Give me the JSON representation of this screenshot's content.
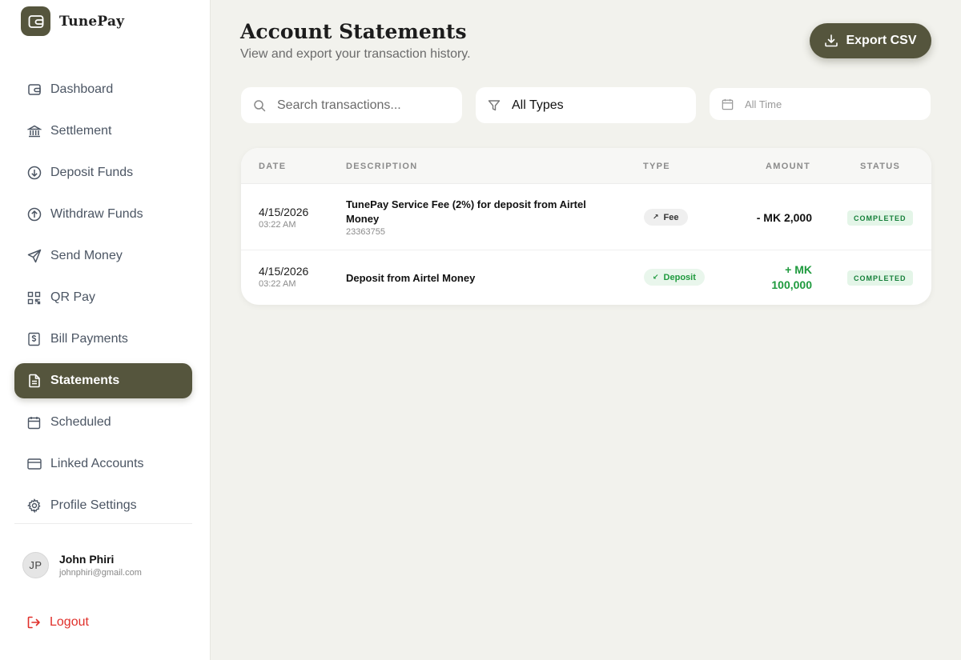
{
  "brand": {
    "name": "TunePay"
  },
  "sidebar": {
    "items": [
      {
        "label": "Dashboard",
        "icon": "wallet-icon"
      },
      {
        "label": "Settlement",
        "icon": "bank-icon"
      },
      {
        "label": "Deposit Funds",
        "icon": "arrow-down-circle-icon"
      },
      {
        "label": "Withdraw Funds",
        "icon": "arrow-up-circle-icon"
      },
      {
        "label": "Send Money",
        "icon": "send-icon"
      },
      {
        "label": "QR Pay",
        "icon": "qr-code-icon"
      },
      {
        "label": "Bill Payments",
        "icon": "receipt-dollar-icon"
      },
      {
        "label": "Statements",
        "icon": "document-icon",
        "active": true
      },
      {
        "label": "Scheduled",
        "icon": "calendar-icon"
      },
      {
        "label": "Linked Accounts",
        "icon": "credit-card-icon"
      },
      {
        "label": "Profile Settings",
        "icon": "gear-icon"
      }
    ],
    "user": {
      "initials": "JP",
      "name": "John Phiri",
      "email": "johnphiri@gmail.com"
    },
    "logout_label": "Logout"
  },
  "header": {
    "title": "Account Statements",
    "subtitle": "View and export your transaction history.",
    "export_label": "Export CSV"
  },
  "filters": {
    "search_placeholder": "Search transactions...",
    "type_value": "All Types",
    "date_value": "All Time"
  },
  "table": {
    "columns": {
      "date": "DATE",
      "description": "DESCRIPTION",
      "type": "TYPE",
      "amount": "AMOUNT",
      "status": "STATUS"
    },
    "rows": [
      {
        "date": "4/15/2026",
        "time": "03:22 AM",
        "description": "TunePay Service Fee (2%) for deposit from Airtel Money",
        "reference": "23363755",
        "type": "Fee",
        "type_arrow": "↗",
        "amount": "- MK 2,000",
        "status": "COMPLETED"
      },
      {
        "date": "4/15/2026",
        "time": "03:22 AM",
        "description": "Deposit from Airtel Money",
        "reference": "",
        "type": "Deposit",
        "type_arrow": "↙",
        "amount": "+ MK 100,000",
        "status": "COMPLETED"
      }
    ]
  },
  "colors": {
    "accent": "#55553d",
    "positive": "#1f9a3e",
    "danger": "#e0302b",
    "background": "#f2f2ed"
  }
}
